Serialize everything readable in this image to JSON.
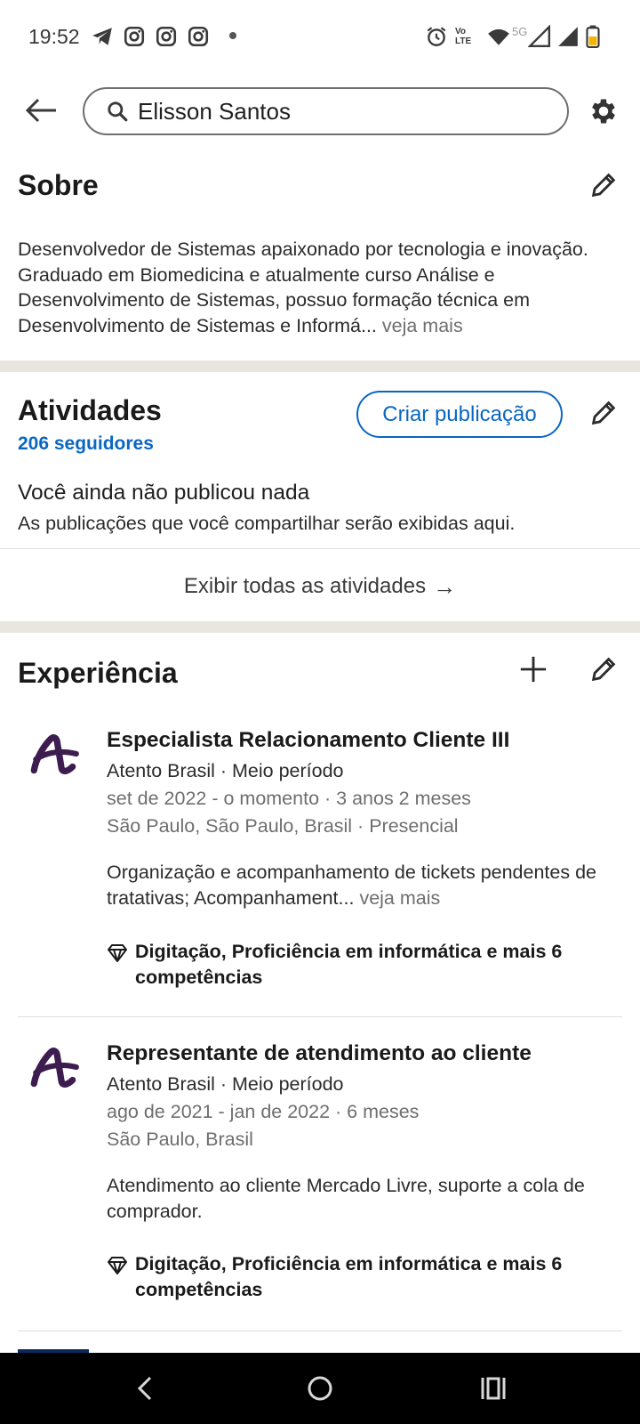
{
  "status_bar": {
    "time": "19:52",
    "notification_icons": [
      "telegram-icon",
      "instagram-icon",
      "instagram-icon",
      "instagram-icon"
    ],
    "network_label": "Vo LTE",
    "network_5g": "5G",
    "system_icons": [
      "alarm-icon",
      "wifi-icon",
      "signal-icon",
      "signal-icon",
      "battery-icon"
    ]
  },
  "header": {
    "search_value": "Elisson Santos"
  },
  "about": {
    "title": "Sobre",
    "text": "Desenvolvedor de Sistemas apaixonado por tecnologia e inovação. Graduado em Biomedicina e atualmente curso Análise e Desenvolvimento de Sistemas, possuo formação técnica em Desenvolvimento de Sistemas e Informá...",
    "see_more": "veja mais"
  },
  "activities": {
    "title": "Atividades",
    "followers": "206 seguidores",
    "create_post_label": "Criar publicação",
    "empty_title": "Você ainda não publicou nada",
    "empty_subtitle": "As publicações que você compartilhar serão exibidas aqui.",
    "show_all_label": "Exibir todas as atividades",
    "show_all_arrow": "→"
  },
  "experience": {
    "title": "Experiência",
    "items": [
      {
        "title": "Especialista Relacionamento Cliente III",
        "company": "Atento Brasil · Meio período",
        "period": "set de 2022 - o momento · 3 anos 2 meses",
        "location": "São Paulo, São Paulo, Brasil · Presencial",
        "description": "Organização e acompanhamento de tickets pendentes de tratativas; Acompanhament...",
        "see_more": "veja mais",
        "skills": "Digitação, Proficiência em informática e mais 6 competências"
      },
      {
        "title": "Representante de atendimento ao cliente",
        "company": "Atento Brasil · Meio período",
        "period": "ago de 2021 - jan de 2022 · 6 meses",
        "location": "São Paulo, Brasil",
        "description": "Atendimento ao cliente Mercado Livre, suporte a cola de comprador.",
        "skills": "Digitação, Proficiência em informática e mais 6 competências"
      }
    ]
  },
  "colors": {
    "accent": "#0a66c2",
    "logo": "#3d1c4f",
    "section_band": "#e9e6df"
  }
}
